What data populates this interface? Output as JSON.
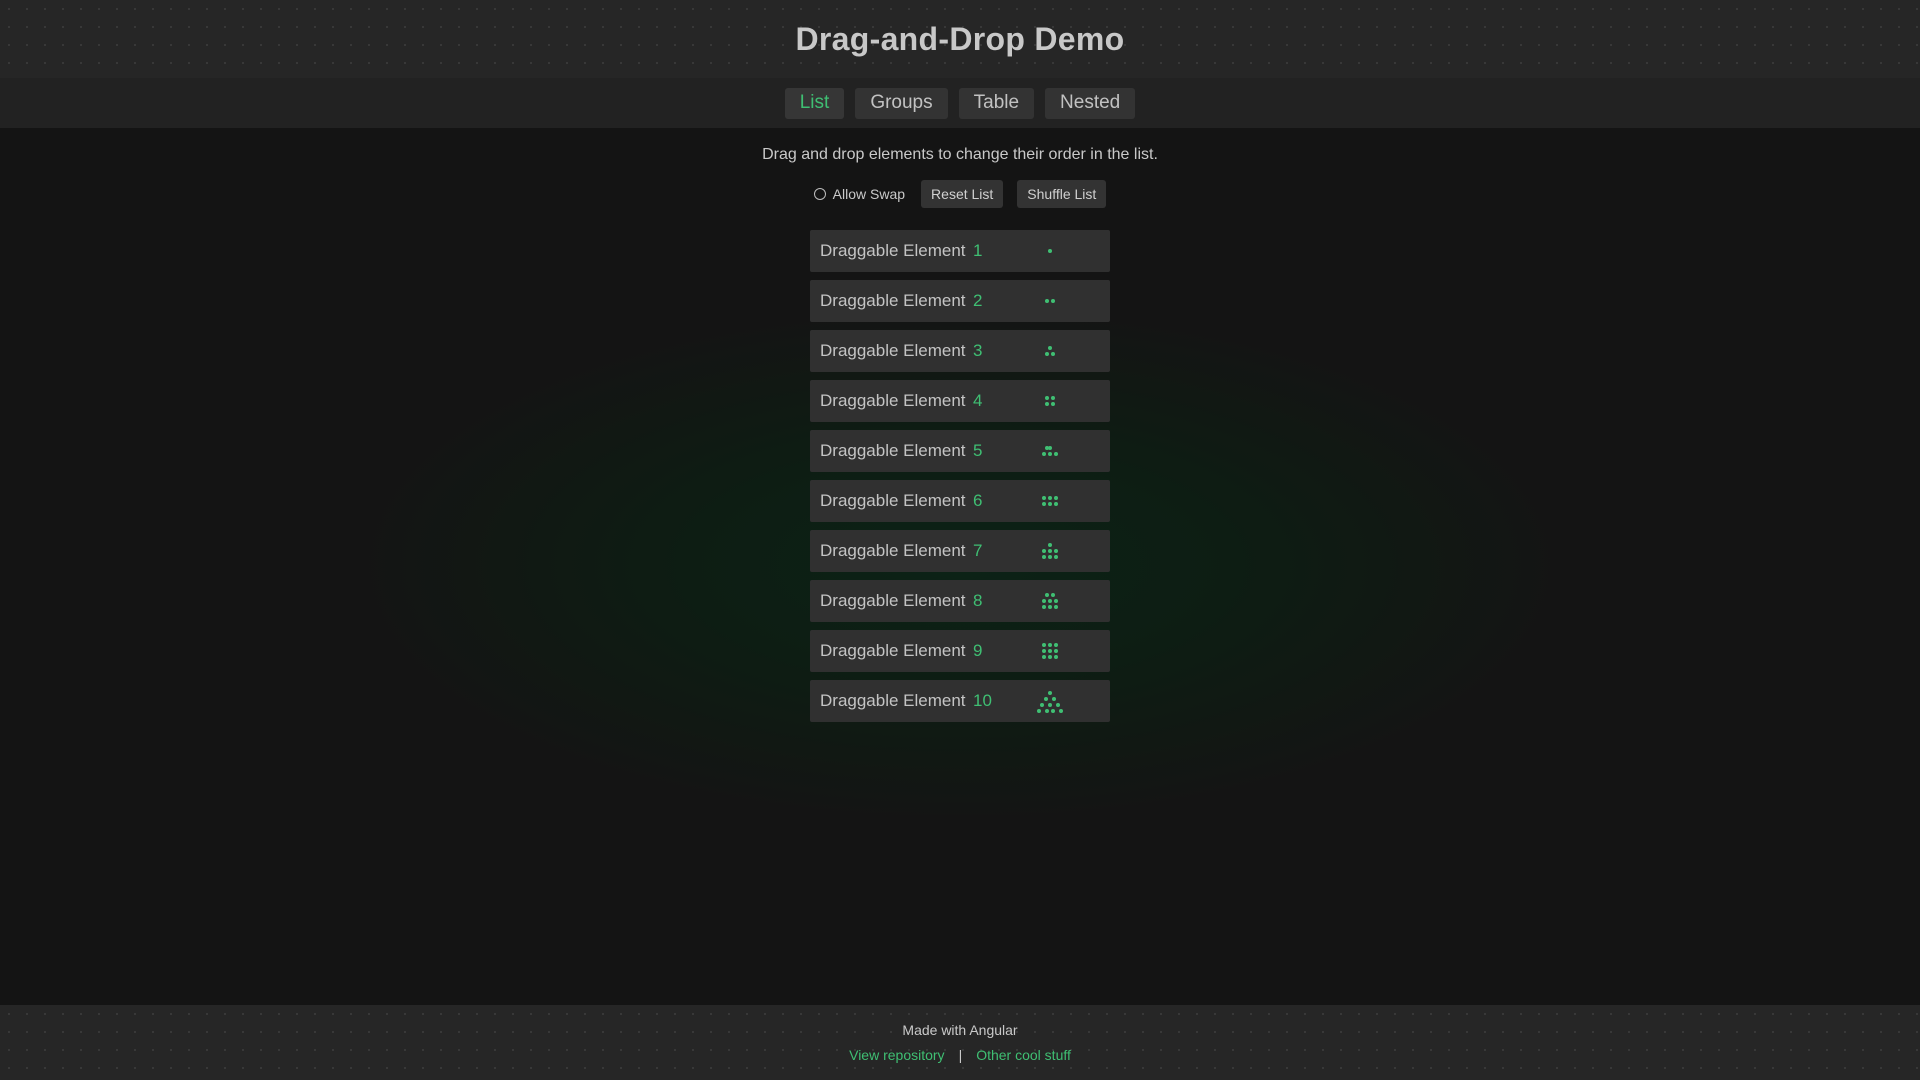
{
  "header": {
    "title": "Drag-and-Drop Demo"
  },
  "nav": {
    "tabs": [
      {
        "label": "List",
        "active": true
      },
      {
        "label": "Groups",
        "active": false
      },
      {
        "label": "Table",
        "active": false
      },
      {
        "label": "Nested",
        "active": false
      }
    ]
  },
  "main": {
    "instructions": "Drag and drop elements to change their order in the list.",
    "controls": {
      "swap_label": "Allow Swap",
      "swap_checked": false,
      "reset_label": "Reset List",
      "shuffle_label": "Shuffle List"
    },
    "items": [
      {
        "label": "Draggable Element",
        "number": "1",
        "pips": 1
      },
      {
        "label": "Draggable Element",
        "number": "2",
        "pips": 2
      },
      {
        "label": "Draggable Element",
        "number": "3",
        "pips": 3
      },
      {
        "label": "Draggable Element",
        "number": "4",
        "pips": 4
      },
      {
        "label": "Draggable Element",
        "number": "5",
        "pips": 5
      },
      {
        "label": "Draggable Element",
        "number": "6",
        "pips": 6
      },
      {
        "label": "Draggable Element",
        "number": "7",
        "pips": 7
      },
      {
        "label": "Draggable Element",
        "number": "8",
        "pips": 8
      },
      {
        "label": "Draggable Element",
        "number": "9",
        "pips": 9
      },
      {
        "label": "Draggable Element",
        "number": "10",
        "pips": 10
      }
    ]
  },
  "footer": {
    "made_with": "Made with Angular",
    "repo_link": "View repository",
    "separator": "|",
    "other_link": "Other cool stuff"
  },
  "colors": {
    "accent": "#3fbf73",
    "background": "#141414",
    "item_background": "#303030"
  }
}
